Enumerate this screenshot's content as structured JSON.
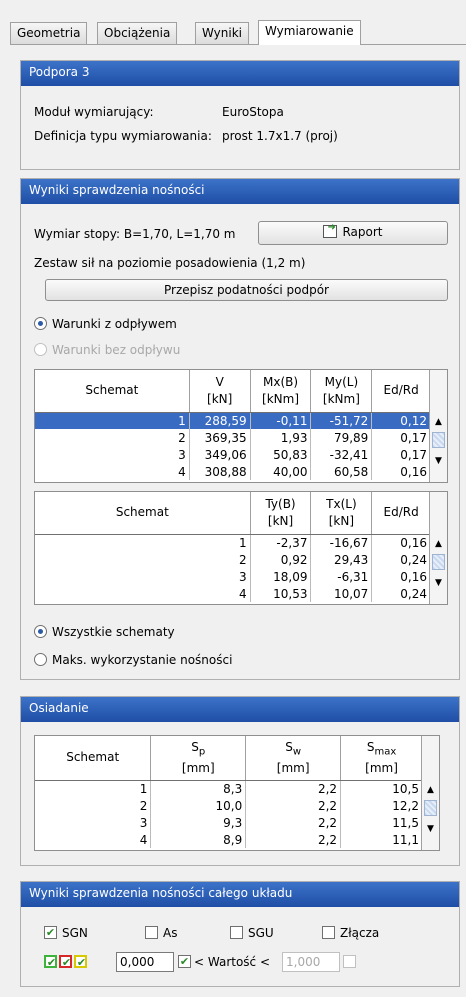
{
  "tabs": [
    "Geometria",
    "Obciążenia",
    "Wyniki",
    "Wymiarowanie"
  ],
  "support": {
    "title": "Podpora 3",
    "module_label": "Moduł wymiarujący:",
    "module_value": "EuroStopa",
    "type_label": "Definicja typu wymiarowania:",
    "type_value": "prost 1.7x1.7 (proj)"
  },
  "capacity": {
    "title": "Wyniki sprawdzenia nośności",
    "dimension_text": "Wymiar stopy: B=1,70, L=1,70 m",
    "report_label": "Raport",
    "forces_text": "Zestaw sił na poziomie posadowienia (1,2 m)",
    "rewrite_label": "Przepisz podatności podpór",
    "drained_label": "Warunki z odpływem",
    "undrained_label": "Warunki bez odpływu",
    "table1": {
      "headers": [
        "Schemat",
        "V\n[kN]",
        "Mx(B)\n[kNm]",
        "My(L)\n[kNm]",
        "Ed/Rd"
      ],
      "rows": [
        [
          "1",
          "288,59",
          "-0,11",
          "-51,72",
          "0,12"
        ],
        [
          "2",
          "369,35",
          "1,93",
          "79,89",
          "0,17"
        ],
        [
          "3",
          "349,06",
          "50,83",
          "-32,41",
          "0,17"
        ],
        [
          "4",
          "308,88",
          "40,00",
          "60,58",
          "0,16"
        ]
      ]
    },
    "table2": {
      "headers": [
        "Schemat",
        "Ty(B)\n[kN]",
        "Tx(L)\n[kN]",
        "Ed/Rd"
      ],
      "rows": [
        [
          "1",
          "-2,37",
          "-16,67",
          "0,16"
        ],
        [
          "2",
          "0,92",
          "29,43",
          "0,24"
        ],
        [
          "3",
          "18,09",
          "-6,31",
          "0,16"
        ],
        [
          "4",
          "10,53",
          "10,07",
          "0,24"
        ]
      ]
    },
    "all_schemes_label": "Wszystkie schematy",
    "max_use_label": "Maks. wykorzystanie nośności"
  },
  "settlement": {
    "title": "Osiadanie",
    "headers": [
      "Schemat",
      "S",
      "p",
      "S",
      "w",
      "S",
      "max",
      "[mm]"
    ],
    "rows": [
      [
        "1",
        "8,3",
        "2,2",
        "10,5"
      ],
      [
        "2",
        "10,0",
        "2,2",
        "12,2"
      ],
      [
        "3",
        "9,3",
        "2,2",
        "11,5"
      ],
      [
        "4",
        "8,9",
        "2,2",
        "11,1"
      ]
    ]
  },
  "overall": {
    "title": "Wyniki sprawdzenia nośności całego układu",
    "sgn_label": "SGN",
    "as_label": "As",
    "sgu_label": "SGU",
    "zlacza_label": "Złącza",
    "min_value": "0,000",
    "cond_label": "< Wartość <",
    "max_value": "1,000"
  },
  "colors": {
    "header_blue": "#2a5fb8",
    "selection_blue": "#3a6bc3"
  }
}
